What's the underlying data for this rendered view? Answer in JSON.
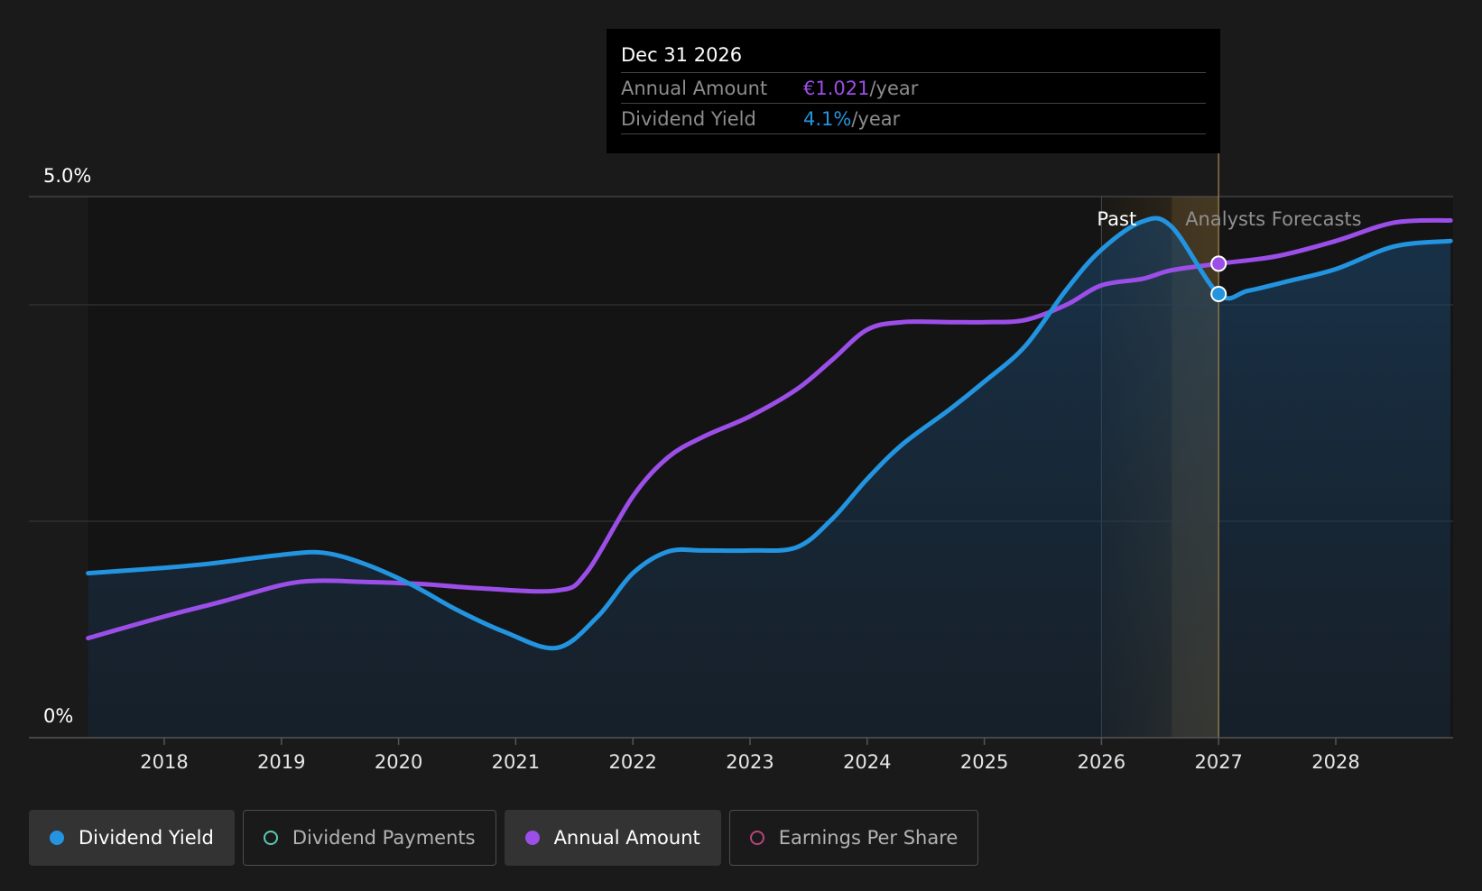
{
  "chart_data": {
    "type": "line",
    "y_axis": {
      "top_label": "5.0%",
      "bottom_label": "0%",
      "ylim": [
        0,
        5.0
      ]
    },
    "x_axis": {
      "ticks": [
        "2018",
        "2019",
        "2020",
        "2021",
        "2022",
        "2023",
        "2024",
        "2025",
        "2026",
        "2027",
        "2028"
      ]
    },
    "regions": {
      "past_label": "Past",
      "forecast_label": "Analysts Forecasts"
    },
    "grid": true,
    "series": [
      {
        "name": "Dividend Yield",
        "color": "#2394df",
        "area": true,
        "points": [
          [
            2017.35,
            1.52
          ],
          [
            2018.0,
            1.57
          ],
          [
            2018.4,
            1.61
          ],
          [
            2019.0,
            1.69
          ],
          [
            2019.35,
            1.71
          ],
          [
            2019.7,
            1.61
          ],
          [
            2020.1,
            1.42
          ],
          [
            2020.5,
            1.18
          ],
          [
            2020.9,
            0.98
          ],
          [
            2021.35,
            0.83
          ],
          [
            2021.7,
            1.12
          ],
          [
            2022.0,
            1.52
          ],
          [
            2022.3,
            1.72
          ],
          [
            2022.6,
            1.73
          ],
          [
            2023.0,
            1.73
          ],
          [
            2023.4,
            1.76
          ],
          [
            2023.7,
            2.02
          ],
          [
            2024.0,
            2.39
          ],
          [
            2024.3,
            2.71
          ],
          [
            2024.7,
            3.03
          ],
          [
            2025.0,
            3.29
          ],
          [
            2025.35,
            3.62
          ],
          [
            2025.7,
            4.14
          ],
          [
            2026.0,
            4.51
          ],
          [
            2026.35,
            4.77
          ],
          [
            2026.6,
            4.72
          ],
          [
            2027.0,
            4.1
          ],
          [
            2027.25,
            4.13
          ],
          [
            2027.6,
            4.22
          ],
          [
            2028.0,
            4.33
          ],
          [
            2028.5,
            4.54
          ],
          [
            2028.98,
            4.59
          ]
        ]
      },
      {
        "name": "Annual Amount",
        "color": "#9c4ee8",
        "area": false,
        "points": [
          [
            2017.35,
            0.92
          ],
          [
            2018.0,
            1.12
          ],
          [
            2018.5,
            1.26
          ],
          [
            2019.0,
            1.41
          ],
          [
            2019.3,
            1.45
          ],
          [
            2019.7,
            1.44
          ],
          [
            2020.2,
            1.42
          ],
          [
            2020.7,
            1.38
          ],
          [
            2021.35,
            1.36
          ],
          [
            2021.6,
            1.52
          ],
          [
            2022.0,
            2.23
          ],
          [
            2022.3,
            2.59
          ],
          [
            2022.6,
            2.78
          ],
          [
            2023.0,
            2.97
          ],
          [
            2023.4,
            3.22
          ],
          [
            2023.7,
            3.49
          ],
          [
            2024.0,
            3.77
          ],
          [
            2024.3,
            3.84
          ],
          [
            2024.7,
            3.84
          ],
          [
            2025.0,
            3.84
          ],
          [
            2025.35,
            3.86
          ],
          [
            2025.7,
            4.0
          ],
          [
            2026.0,
            4.18
          ],
          [
            2026.35,
            4.24
          ],
          [
            2026.6,
            4.32
          ],
          [
            2027.0,
            4.38
          ],
          [
            2027.5,
            4.45
          ],
          [
            2028.0,
            4.59
          ],
          [
            2028.5,
            4.76
          ],
          [
            2028.98,
            4.78
          ]
        ]
      }
    ],
    "highlight_x": 2027.0
  },
  "tooltip": {
    "date": "Dec 31 2026",
    "annual_label": "Annual Amount",
    "annual_value": "€1.021",
    "annual_unit": "/year",
    "yield_label": "Dividend Yield",
    "yield_value": "4.1%",
    "yield_unit": "/year"
  },
  "legend": [
    {
      "label": "Dividend Yield",
      "color": "#2394df",
      "active": true
    },
    {
      "label": "Dividend Payments",
      "color": "#5cc8b6",
      "active": false
    },
    {
      "label": "Annual Amount",
      "color": "#9c4ee8",
      "active": true
    },
    {
      "label": "Earnings Per Share",
      "color": "#b8457a",
      "active": false
    }
  ]
}
